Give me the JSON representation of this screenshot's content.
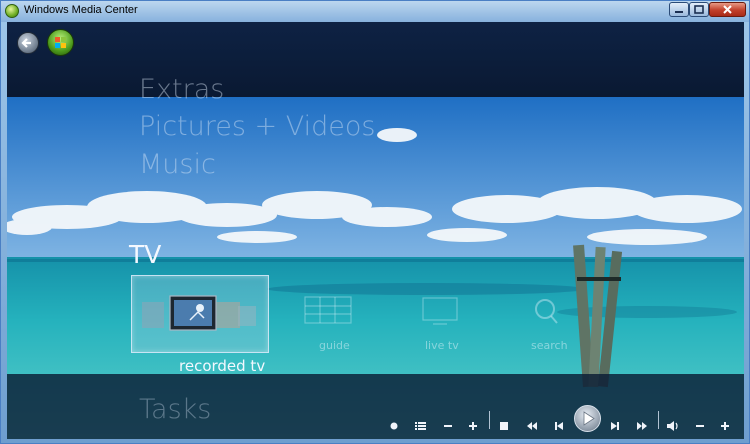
{
  "window": {
    "title": "Windows Media Center",
    "controls": {
      "minimize": "minimize",
      "maximize": "maximize",
      "close": "close"
    }
  },
  "nav": {
    "back_icon": "back-arrow-icon",
    "start_icon": "windows-start-orb-icon"
  },
  "menu": {
    "items_above": [
      "Extras",
      "Pictures + Videos",
      "Music"
    ],
    "current_section": "TV",
    "item_below": "Tasks",
    "tv_strip": [
      {
        "label": "recorded tv",
        "icon": "recorded-tv-icon",
        "selected": true
      },
      {
        "label": "guide",
        "icon": "guide-icon",
        "selected": false
      },
      {
        "label": "live tv",
        "icon": "live-tv-icon",
        "selected": false
      },
      {
        "label": "search",
        "icon": "search-icon",
        "selected": false
      }
    ]
  },
  "transport": {
    "buttons": [
      "record-icon",
      "menu-list-icon",
      "channel-down-icon",
      "channel-up-icon",
      "stop-icon",
      "rewind-icon",
      "skip-back-icon",
      "play-icon",
      "skip-forward-icon",
      "fast-forward-icon",
      "volume-icon",
      "volume-down-icon",
      "volume-up-icon"
    ]
  },
  "colors": {
    "titlebar": "#9fc7ea",
    "background": "#0c1c3a",
    "sky": "#2e7fd0",
    "sea": "#27b2bf"
  }
}
